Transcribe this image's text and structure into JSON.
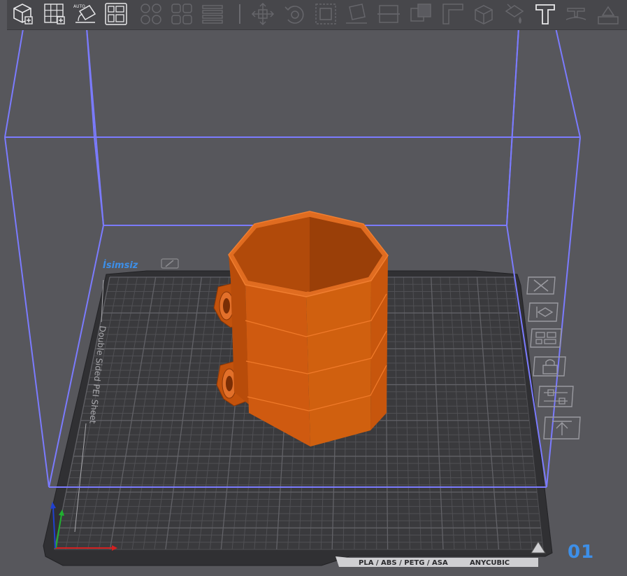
{
  "toolbar": {
    "items": [
      {
        "icon": "add-cube-icon",
        "enabled": true
      },
      {
        "icon": "add-grid-icon",
        "enabled": true
      },
      {
        "icon": "auto-orient-icon",
        "label": "AUTO",
        "enabled": true
      },
      {
        "icon": "arrange-icon",
        "enabled": true
      },
      {
        "icon": "split-objects-icon",
        "enabled": false
      },
      {
        "icon": "split-parts-icon",
        "enabled": false
      },
      {
        "icon": "layers-icon",
        "enabled": false
      },
      {
        "icon": "move-icon",
        "enabled": false
      },
      {
        "icon": "rotate-icon",
        "enabled": false
      },
      {
        "icon": "scale-icon",
        "enabled": false
      },
      {
        "icon": "lay-flat-icon",
        "enabled": false
      },
      {
        "icon": "cut-icon",
        "enabled": false
      },
      {
        "icon": "boolean-icon",
        "enabled": false
      },
      {
        "icon": "measure-icon",
        "enabled": false
      },
      {
        "icon": "support-paint-icon",
        "enabled": false
      },
      {
        "icon": "seam-paint-icon",
        "enabled": false
      },
      {
        "icon": "text-icon",
        "enabled": true
      },
      {
        "icon": "emboss-icon",
        "enabled": false
      },
      {
        "icon": "assembly-icon",
        "enabled": false
      }
    ]
  },
  "plate": {
    "name": "İsimsiz",
    "sheet_label": "Double Sided PEI Sheet",
    "materials_label": "PLA / ABS / PETG / ASA",
    "brand_label": "ANYCUBIC",
    "number": "01"
  },
  "plate_tools": [
    {
      "icon": "delete-plate-icon"
    },
    {
      "icon": "orient-plate-icon"
    },
    {
      "icon": "arrange-plate-icon"
    },
    {
      "icon": "lock-plate-icon"
    },
    {
      "icon": "plate-settings-icon"
    },
    {
      "icon": "move-to-plate-icon"
    }
  ],
  "colors": {
    "background": "#57575c",
    "bed": "#313134",
    "build_volume": "#7b7bff",
    "model": "#cc5a10",
    "accent": "#3d8fe8"
  }
}
